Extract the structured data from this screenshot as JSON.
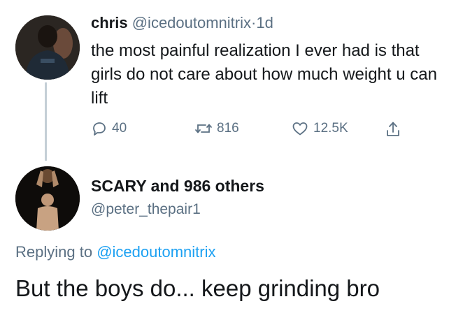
{
  "tweet": {
    "name": "chris",
    "handle": "@icedoutomnitrix",
    "separator": "·",
    "time": "1d",
    "text": "the most painful realization I ever had is that girls do not care about how much weight u can lift",
    "actions": {
      "replies": "40",
      "retweets": "816",
      "likes": "12.5K"
    }
  },
  "reply": {
    "name": "SCARY and 986 others",
    "handle": "@peter_thepair1",
    "replying_prefix": "Replying to",
    "replying_mention": "@icedoutomnitrix",
    "text": "But the boys do... keep grinding bro"
  },
  "icons": {
    "reply": "reply-icon",
    "retweet": "retweet-icon",
    "like": "heart-icon",
    "share": "share-icon"
  },
  "colors": {
    "text": "#14171a",
    "muted": "#5b7083",
    "link": "#1da1f2",
    "thread_line": "#c4cfd6"
  }
}
